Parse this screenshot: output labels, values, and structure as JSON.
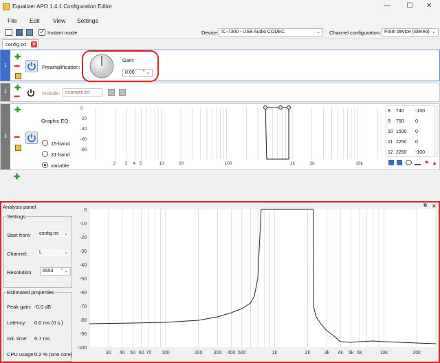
{
  "window": {
    "title": "Equalizer APO 1.4.1 Configuration Editor",
    "minimize": "—",
    "maximize": "☐",
    "close": "✕"
  },
  "menu": [
    "File",
    "Edit",
    "View",
    "Settings"
  ],
  "toolbar": {
    "instant_mode_label": "Instant mode",
    "instant_mode_checked": true,
    "device_label": "Device:",
    "device_value": "IC-7300 - USB Audio CODEC",
    "channel_config_label": "Channel configuration:",
    "channel_config_value": "From device (Stereo)"
  },
  "tab": {
    "label": "config.txt"
  },
  "rows": [
    {
      "number": "1",
      "preamp_label": "Preamplification:",
      "gain_label": "Gain:",
      "gain_value": "0.00"
    },
    {
      "number": "2",
      "include_label": "Include:",
      "include_placeholder": "example.txt"
    },
    {
      "number": "3",
      "geq_label": "Graphic EQ:",
      "band_options": [
        "15-band",
        "31-band",
        "variable"
      ],
      "selected_band": "variable"
    }
  ],
  "geq": {
    "y_ticks": [
      "0",
      "-20",
      "-40",
      "-60",
      "-80"
    ],
    "x_ticks": [
      "2",
      "3",
      "4",
      "5",
      "10",
      "20",
      "100",
      "1k",
      "2k",
      "10k"
    ],
    "table": [
      {
        "idx": "8",
        "freq": "740",
        "gain": "-100"
      },
      {
        "idx": "9",
        "freq": "750",
        "gain": "0"
      },
      {
        "idx": "10",
        "freq": "1500",
        "gain": "0"
      },
      {
        "idx": "11",
        "freq": "2250",
        "gain": "0"
      },
      {
        "idx": "12",
        "freq": "2260",
        "gain": "-100"
      }
    ]
  },
  "analysis": {
    "header": "Analysis panel",
    "settings_title": "Settings",
    "start_from_label": "Start from:",
    "start_from_value": "config.txt",
    "channel_label": "Channel:",
    "channel_value": "L",
    "resolution_label": "Resolution:",
    "resolution_value": "6553",
    "estimated_title": "Estimated properties",
    "peak_gain_label": "Peak gain:",
    "peak_gain_value": "-0.0 dB",
    "latency_label": "Latency:",
    "latency_value": "0.0 ms (0 s.)",
    "init_time_label": "Init. time:",
    "init_time_value": "6.7 ms",
    "cpu_label": "CPU usage:",
    "cpu_value": "0.2 % (one core)"
  },
  "chart_data": [
    {
      "type": "line",
      "xscale": "log",
      "xlim": [
        20,
        30000
      ],
      "ylim": [
        -100,
        0
      ],
      "y_ticks": [
        "0",
        "-10",
        "-20",
        "-30",
        "-40",
        "-50",
        "-60",
        "-70",
        "-80",
        "-90",
        "-100"
      ],
      "x_ticks": [
        "30",
        "40",
        "50",
        "60",
        "70",
        "100",
        "200",
        "300",
        "400",
        "500",
        "1k",
        "2k",
        "3k",
        "4k",
        "5k",
        "6k",
        "10k",
        "20k"
      ],
      "series": [
        {
          "x": [
            20,
            50,
            100,
            200,
            300,
            400,
            500,
            600,
            650,
            700,
            740,
            750,
            1000,
            1500,
            2250,
            2260,
            2400,
            2700,
            3000,
            3500,
            4000,
            5000,
            6000,
            8000,
            10000,
            20000,
            30000
          ],
          "values": [
            -83,
            -82.5,
            -82,
            -80.5,
            -78,
            -75,
            -72,
            -68,
            -63,
            -50,
            -10,
            0,
            0,
            0,
            0,
            -70,
            -78,
            -84,
            -88,
            -92,
            -96,
            -96.5,
            -96,
            -95.5,
            -96,
            -97,
            -97.5
          ]
        }
      ]
    }
  ]
}
